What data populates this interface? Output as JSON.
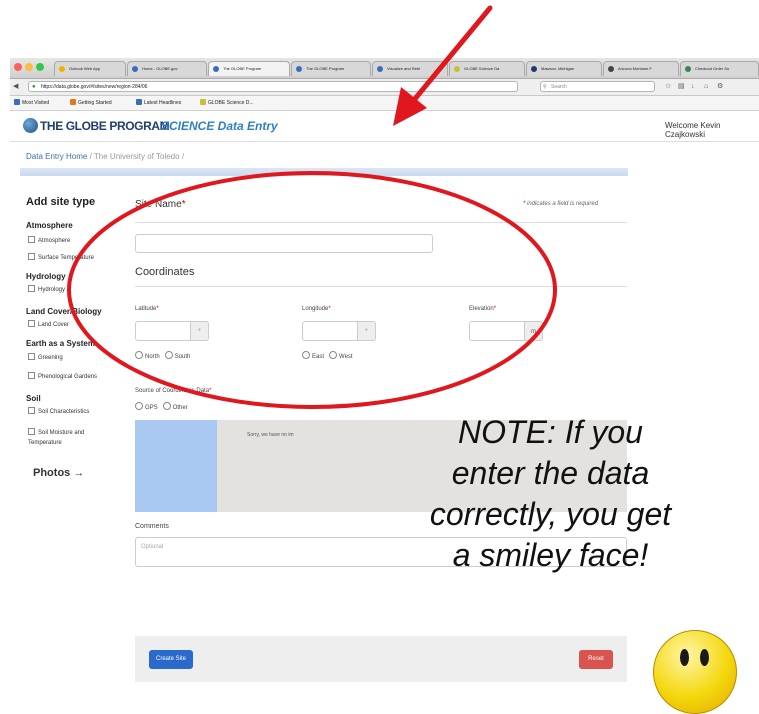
{
  "browser": {
    "tabs": [
      {
        "label": "Outlook Web App"
      },
      {
        "label": "Home - GLOBE.gov"
      },
      {
        "label": "The GLOBE Program"
      },
      {
        "label": "The GLOBE Program"
      },
      {
        "label": "Visualize and Retri"
      },
      {
        "label": "GLOBE Science Da"
      },
      {
        "label": "Mawson, Michigan"
      },
      {
        "label": "Arizona Montane F"
      },
      {
        "label": "Checkout Order Su"
      }
    ],
    "url": "https://data.globe.gov/#/sites/new/region-284/06",
    "search_placeholder": "Search",
    "bookmarks": [
      "Most Visited",
      "Getting Started",
      "Latest Headlines",
      "GLOBE Science D..."
    ]
  },
  "header": {
    "logo": "THE GLOBE PROGRAM",
    "subtitle": "SCIENCE Data Entry",
    "welcome": "Welcome Kevin Czajkowski"
  },
  "breadcrumb": {
    "home": "Data Entry Home",
    "separator": "/",
    "current": "The University of Toledo"
  },
  "sidebar": {
    "title": "Add site type",
    "groups": [
      {
        "heading": "Atmosphere",
        "items": [
          "Atmosphere",
          "Surface Temperature"
        ]
      },
      {
        "heading": "Hydrology",
        "items": [
          "Hydrology"
        ]
      },
      {
        "heading": "Land Cover/Biology",
        "items": [
          "Land Cover"
        ]
      },
      {
        "heading": "Earth as a System",
        "items": [
          "Greening",
          "Phenological Gardens"
        ]
      },
      {
        "heading": "Soil",
        "items": [
          "Soil Characteristics",
          "Soil Moisture and Temperature"
        ]
      }
    ],
    "photos": "Photos →"
  },
  "form": {
    "site_name_label": "Site Name",
    "required_star": "*",
    "required_note": "indicates a field is required",
    "coordinates_heading": "Coordinates",
    "latitude_label": "Latitude",
    "longitude_label": "Longitude",
    "elevation_label": "Elevation",
    "elevation_unit": "m",
    "stepper_symbol": "°",
    "north": "North",
    "south": "South",
    "east": "East",
    "west": "West",
    "source_label": "Source of Coordinates Data",
    "gps": "GPS",
    "other": "Other",
    "map_message": "Sorry, we have no im",
    "comments_label": "Comments",
    "comments_placeholder": "Optional",
    "create_button": "Create Site",
    "reset_button": "Reset"
  },
  "note": {
    "line1": "NOTE: If you",
    "line2": "enter the data",
    "line3": "correctly, you get",
    "line4": "a smiley face!"
  },
  "colors": {
    "annotation_red": "#e0171d",
    "primary_button": "#2a6acb",
    "reset_button": "#d9534f",
    "link_blue": "#3a6fb5"
  }
}
